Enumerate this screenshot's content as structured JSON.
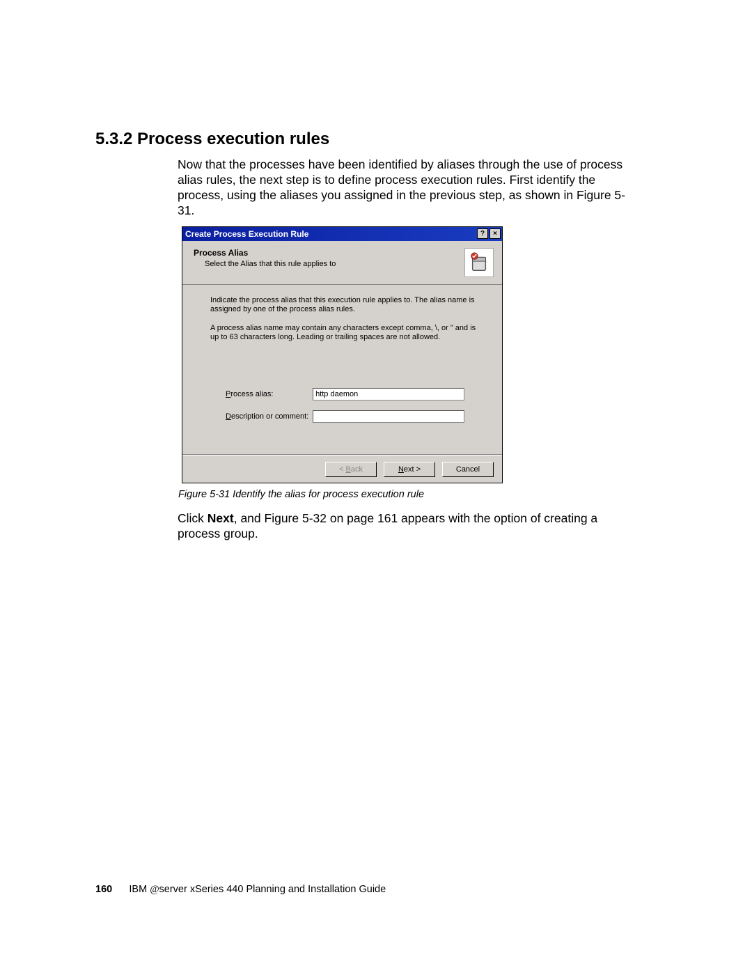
{
  "heading": "5.3.2  Process execution rules",
  "intro": "Now that the processes have been identified by aliases through the use of process alias rules, the next step is to define process execution rules. First identify the process, using the aliases you assigned in the previous step, as shown in Figure 5-31.",
  "dialog": {
    "title": "Create Process Execution Rule",
    "help_btn": "?",
    "close_btn": "×",
    "header_title": "Process Alias",
    "header_sub": "Select the Alias that this rule applies to",
    "body_p1": "Indicate the process alias that this execution rule applies to.  The alias name is assigned by one of the process alias rules.",
    "body_p2": "A process alias name may contain any characters except comma, \\, or \" and is up to 63 characters long.  Leading or trailing spaces are not allowed.",
    "label_process_alias_pre": "P",
    "label_process_alias_rest": "rocess alias:",
    "label_desc_pre": "D",
    "label_desc_rest": "escription or comment:",
    "value_process_alias": "http daemon",
    "value_description": "",
    "btn_back_prefix": "< ",
    "btn_back_u": "B",
    "btn_back_rest": "ack",
    "btn_next_u": "N",
    "btn_next_rest": "ext >",
    "btn_cancel": "Cancel"
  },
  "figure_caption": "Figure 5-31   Identify the alias for process execution rule",
  "post_para_pre": "Click ",
  "post_para_bold": "Next",
  "post_para_post": ", and Figure 5-32 on page 161 appears with the option of creating a process group.",
  "footer": {
    "page_number": "160",
    "text_pre": "IBM ",
    "text_at": "@",
    "text_server": "server",
    "text_post": " xSeries 440 Planning and Installation Guide"
  }
}
